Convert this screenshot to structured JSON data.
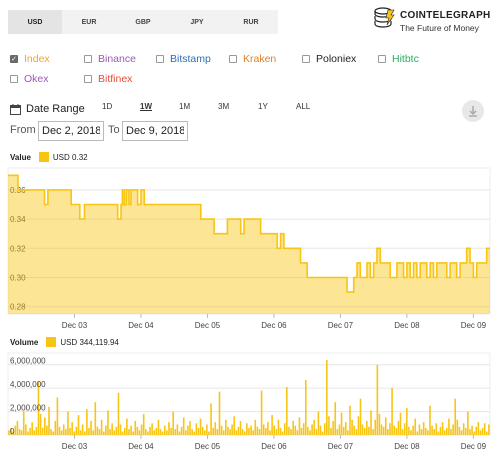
{
  "currency_tabs": [
    {
      "label": "USD",
      "active": true
    },
    {
      "label": "EUR",
      "active": false
    },
    {
      "label": "GBP",
      "active": false
    },
    {
      "label": "JPY",
      "active": false
    },
    {
      "label": "RUR",
      "active": false
    }
  ],
  "brand": {
    "name": "COINTELEGRAPH",
    "tagline": "The Future of Money"
  },
  "sources": [
    {
      "label": "Index",
      "checked": true,
      "color": "#f5a623"
    },
    {
      "label": "Binance",
      "checked": false,
      "color": "#9b59b6"
    },
    {
      "label": "Bitstamp",
      "checked": false,
      "color": "#2c6fb8"
    },
    {
      "label": "Kraken",
      "checked": false,
      "color": "#e67e22"
    },
    {
      "label": "Poloniex",
      "checked": false,
      "color": "#222222"
    },
    {
      "label": "Hitbtc",
      "checked": false,
      "color": "#27ae60"
    },
    {
      "label": "Okex",
      "checked": false,
      "color": "#9b59b6"
    },
    {
      "label": "Bitfinex",
      "checked": false,
      "color": "#e74c3c"
    }
  ],
  "date_range": {
    "label": "Date Range",
    "options": [
      "1D",
      "1W",
      "1M",
      "3M",
      "1Y",
      "ALL"
    ],
    "active": "1W",
    "from_label": "From",
    "from_value": "Dec 2, 2018",
    "to_label": "To",
    "to_value": "Dec 9, 2018"
  },
  "chart_data": [
    {
      "type": "area",
      "title": "Value",
      "legend": "USD",
      "legend_value": "0.32",
      "color": "#f8c514",
      "xticks": [
        "Dec 03",
        "Dec 04",
        "Dec 05",
        "Dec 06",
        "Dec 07",
        "Dec 08",
        "Dec 09"
      ],
      "ylim": [
        0.275,
        0.375
      ],
      "yticks": [
        "0.28",
        "0.30",
        "0.32",
        "0.34",
        "0.36"
      ],
      "ytick_values": [
        0.28,
        0.3,
        0.32,
        0.34,
        0.36
      ],
      "x": [
        2.0,
        2.05,
        2.12,
        2.15,
        2.2,
        2.3,
        2.4,
        2.5,
        2.55,
        2.6,
        2.7,
        2.75,
        2.85,
        2.95,
        3.0,
        3.05,
        3.08,
        3.15,
        3.2,
        3.3,
        3.4,
        3.5,
        3.6,
        3.65,
        3.7,
        3.72,
        3.75,
        3.78,
        3.82,
        3.85,
        3.9,
        3.95,
        4.0,
        4.05,
        4.1,
        4.2,
        4.3,
        4.4,
        4.5,
        4.6,
        4.7,
        4.8,
        4.9,
        4.95,
        5.0,
        5.05,
        5.1,
        5.2,
        5.3,
        5.4,
        5.45,
        5.5,
        5.55,
        5.6,
        5.7,
        5.8,
        5.9,
        6.0,
        6.05,
        6.1,
        6.15,
        6.2,
        6.25,
        6.3,
        6.35,
        6.4,
        6.5,
        6.55,
        6.6,
        6.7,
        6.8,
        6.9,
        7.0,
        7.05,
        7.1,
        7.15,
        7.2,
        7.25,
        7.3,
        7.35,
        7.4,
        7.45,
        7.5,
        7.55,
        7.6,
        7.65,
        7.7,
        7.75,
        7.8,
        7.85,
        7.9,
        7.95,
        8.0,
        8.05,
        8.1,
        8.15,
        8.2,
        8.25,
        8.3,
        8.35,
        8.4,
        8.45,
        8.5,
        8.55,
        8.6,
        8.65,
        8.7,
        8.75,
        8.8,
        8.85,
        8.9,
        8.95,
        9.0,
        9.05,
        9.1,
        9.15,
        9.2,
        9.25
      ],
      "values": [
        0.37,
        0.37,
        0.37,
        0.36,
        0.36,
        0.36,
        0.36,
        0.36,
        0.35,
        0.36,
        0.36,
        0.36,
        0.36,
        0.35,
        0.35,
        0.35,
        0.34,
        0.35,
        0.35,
        0.35,
        0.35,
        0.35,
        0.35,
        0.34,
        0.35,
        0.36,
        0.35,
        0.36,
        0.35,
        0.36,
        0.36,
        0.35,
        0.36,
        0.35,
        0.35,
        0.35,
        0.35,
        0.35,
        0.35,
        0.35,
        0.35,
        0.35,
        0.34,
        0.34,
        0.34,
        0.34,
        0.33,
        0.33,
        0.34,
        0.34,
        0.34,
        0.33,
        0.34,
        0.34,
        0.34,
        0.33,
        0.33,
        0.33,
        0.32,
        0.33,
        0.32,
        0.32,
        0.32,
        0.32,
        0.32,
        0.31,
        0.3,
        0.3,
        0.3,
        0.3,
        0.3,
        0.3,
        0.3,
        0.3,
        0.29,
        0.29,
        0.3,
        0.31,
        0.3,
        0.3,
        0.31,
        0.3,
        0.31,
        0.32,
        0.31,
        0.31,
        0.31,
        0.3,
        0.3,
        0.31,
        0.31,
        0.3,
        0.31,
        0.3,
        0.31,
        0.3,
        0.31,
        0.31,
        0.3,
        0.31,
        0.3,
        0.31,
        0.31,
        0.31,
        0.3,
        0.31,
        0.31,
        0.3,
        0.31,
        0.31,
        0.32,
        0.31,
        0.3,
        0.31,
        0.31,
        0.31,
        0.32,
        0.32
      ]
    },
    {
      "type": "bar",
      "title": "Volume",
      "legend": "USD",
      "legend_value": "344,119.94",
      "color": "#f8c514",
      "xticks": [
        "Dec 03",
        "Dec 04",
        "Dec 05",
        "Dec 06",
        "Dec 07",
        "Dec 08",
        "Dec 09"
      ],
      "ylim": [
        0,
        7000000
      ],
      "yticks": [
        "0",
        "2,000,000",
        "4,000,000",
        "6,000,000"
      ],
      "ytick_values": [
        0,
        2000000,
        4000000,
        6000000
      ],
      "values": [
        400000,
        600000,
        300000,
        800000,
        1200000,
        500000,
        400000,
        2000000,
        900000,
        300000,
        600000,
        1100000,
        400000,
        700000,
        4600000,
        1800000,
        600000,
        1500000,
        800000,
        2400000,
        500000,
        300000,
        1200000,
        3200000,
        700000,
        400000,
        900000,
        500000,
        2000000,
        600000,
        1100000,
        300000,
        700000,
        1700000,
        400000,
        900000,
        300000,
        2200000,
        600000,
        1200000,
        400000,
        2800000,
        700000,
        500000,
        1300000,
        300000,
        800000,
        2100000,
        500000,
        1000000,
        400000,
        700000,
        3600000,
        900000,
        300000,
        600000,
        1400000,
        500000,
        800000,
        300000,
        1200000,
        700000,
        400000,
        900000,
        1800000,
        500000,
        300000,
        700000,
        1000000,
        400000,
        600000,
        1300000,
        500000,
        300000,
        800000,
        400000,
        1100000,
        600000,
        2000000,
        500000,
        900000,
        300000,
        700000,
        1500000,
        400000,
        800000,
        1200000,
        500000,
        300000,
        1000000,
        600000,
        1400000,
        700000,
        400000,
        900000,
        300000,
        2700000,
        600000,
        1100000,
        500000,
        3700000,
        800000,
        400000,
        1300000,
        700000,
        500000,
        900000,
        1600000,
        400000,
        700000,
        1200000,
        500000,
        300000,
        1000000,
        600000,
        800000,
        400000,
        1300000,
        700000,
        500000,
        3800000,
        900000,
        600000,
        1100000,
        400000,
        1700000,
        800000,
        500000,
        1300000,
        600000,
        300000,
        1000000,
        4100000,
        700000,
        500000,
        1200000,
        800000,
        400000,
        1500000,
        600000,
        1000000,
        4700000,
        700000,
        400000,
        900000,
        1300000,
        500000,
        2000000,
        800000,
        300000,
        1000000,
        6400000,
        1600000,
        600000,
        1200000,
        2800000,
        500000,
        900000,
        1900000,
        700000,
        1100000,
        400000,
        2500000,
        1300000,
        800000,
        500000,
        1600000,
        3100000,
        900000,
        600000,
        1200000,
        700000,
        2100000,
        500000,
        1300000,
        6000000,
        1800000,
        900000,
        700000,
        1500000,
        500000,
        1000000,
        4000000,
        800000,
        600000,
        1200000,
        1900000,
        500000,
        1000000,
        2300000,
        700000,
        400000,
        800000,
        1400000,
        300000,
        900000,
        500000,
        1100000,
        600000,
        400000,
        2500000,
        800000,
        500000,
        1000000,
        300000,
        700000,
        1100000,
        400000,
        600000,
        1400000,
        500000,
        900000,
        3100000,
        1300000,
        700000,
        400000,
        1000000,
        600000,
        2000000,
        500000,
        800000,
        300000,
        700000,
        1100000,
        400000,
        600000,
        1000000,
        300000,
        900000
      ]
    }
  ]
}
